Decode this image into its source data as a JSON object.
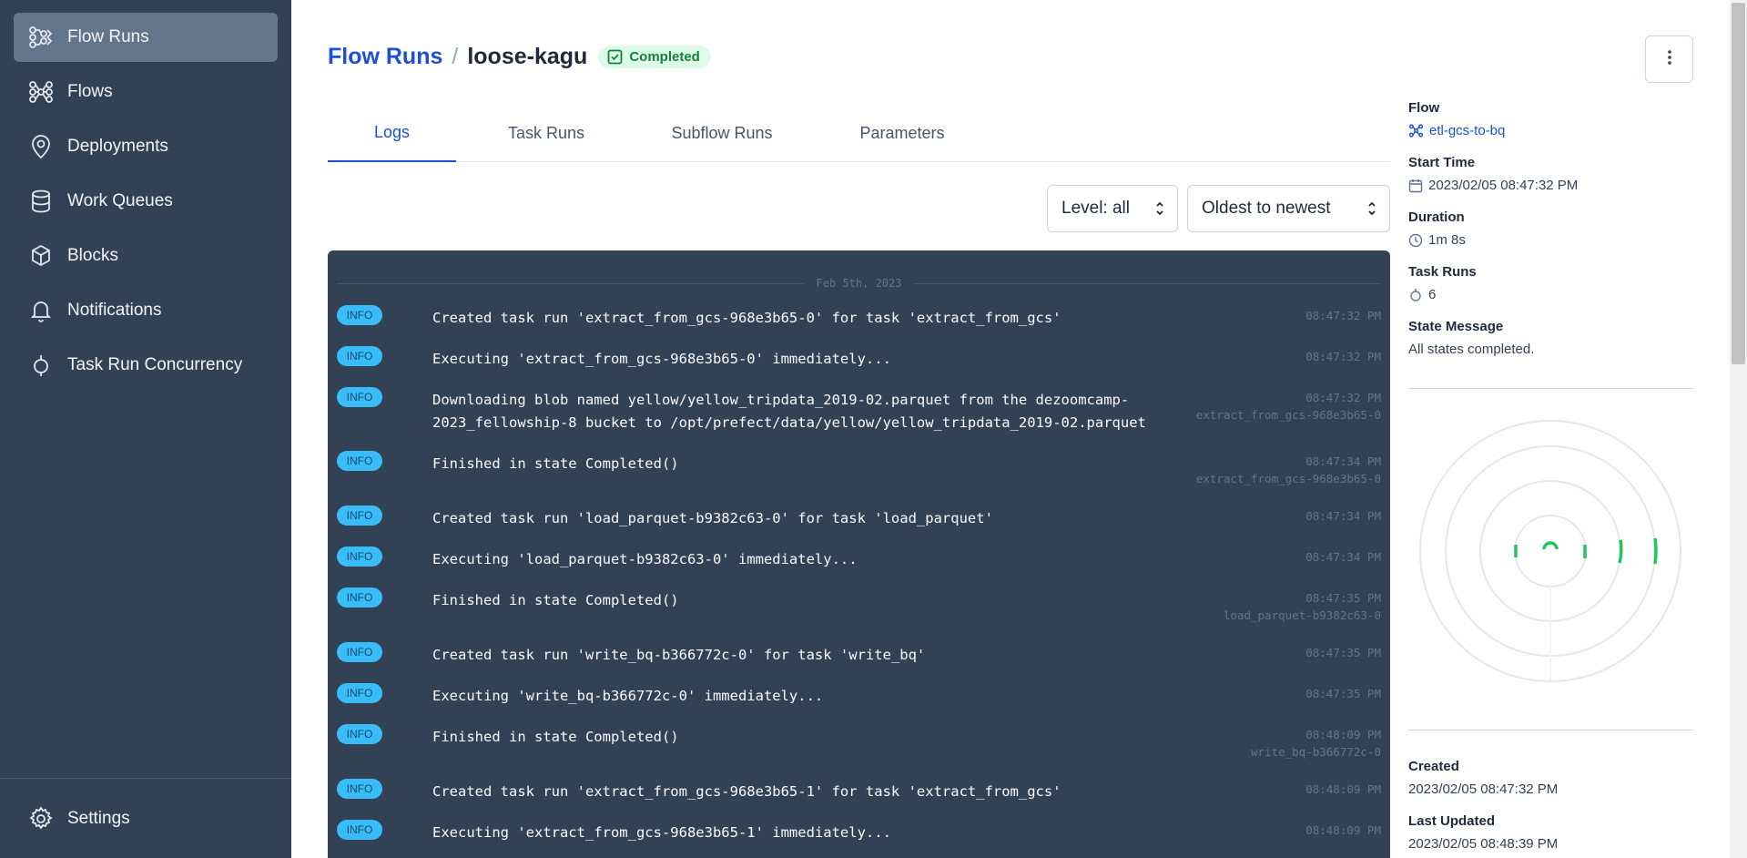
{
  "sidebar": {
    "items": [
      {
        "label": "Flow Runs",
        "icon": "flow-runs-icon"
      },
      {
        "label": "Flows",
        "icon": "flows-icon"
      },
      {
        "label": "Deployments",
        "icon": "location-pin-icon"
      },
      {
        "label": "Work Queues",
        "icon": "database-icon"
      },
      {
        "label": "Blocks",
        "icon": "cube-icon"
      },
      {
        "label": "Notifications",
        "icon": "bell-icon"
      },
      {
        "label": "Task Run Concurrency",
        "icon": "concurrency-icon"
      }
    ],
    "settings_label": "Settings"
  },
  "header": {
    "breadcrumb_root": "Flow Runs",
    "separator": "/",
    "run_name": "loose-kagu",
    "status": "Completed"
  },
  "tabs": [
    {
      "label": "Logs"
    },
    {
      "label": "Task Runs"
    },
    {
      "label": "Subflow Runs"
    },
    {
      "label": "Parameters"
    }
  ],
  "filters": {
    "level": "Level: all",
    "sort": "Oldest to newest"
  },
  "logs": {
    "date": "Feb 5th, 2023",
    "entries": [
      {
        "level": "INFO",
        "message": "Created task run 'extract_from_gcs-968e3b65-0' for task 'extract_from_gcs'",
        "time": "08:47:32 PM",
        "task": ""
      },
      {
        "level": "INFO",
        "message": "Executing 'extract_from_gcs-968e3b65-0' immediately...",
        "time": "08:47:32 PM",
        "task": ""
      },
      {
        "level": "INFO",
        "message": "Downloading blob named yellow/yellow_tripdata_2019-02.parquet from the dezoomcamp-2023_fellowship-8 bucket to /opt/prefect/data/yellow/yellow_tripdata_2019-02.parquet",
        "time": "08:47:32 PM",
        "task": "extract_from_gcs-968e3b65-0"
      },
      {
        "level": "INFO",
        "message": "Finished in state Completed()",
        "time": "08:47:34 PM",
        "task": "extract_from_gcs-968e3b65-0"
      },
      {
        "level": "INFO",
        "message": "Created task run 'load_parquet-b9382c63-0' for task 'load_parquet'",
        "time": "08:47:34 PM",
        "task": ""
      },
      {
        "level": "INFO",
        "message": "Executing 'load_parquet-b9382c63-0' immediately...",
        "time": "08:47:34 PM",
        "task": ""
      },
      {
        "level": "INFO",
        "message": "Finished in state Completed()",
        "time": "08:47:35 PM",
        "task": "load_parquet-b9382c63-0"
      },
      {
        "level": "INFO",
        "message": "Created task run 'write_bq-b366772c-0' for task 'write_bq'",
        "time": "08:47:35 PM",
        "task": ""
      },
      {
        "level": "INFO",
        "message": "Executing 'write_bq-b366772c-0' immediately...",
        "time": "08:47:35 PM",
        "task": ""
      },
      {
        "level": "INFO",
        "message": "Finished in state Completed()",
        "time": "08:48:09 PM",
        "task": "write_bq-b366772c-0"
      },
      {
        "level": "INFO",
        "message": "Created task run 'extract_from_gcs-968e3b65-1' for task 'extract_from_gcs'",
        "time": "08:48:09 PM",
        "task": ""
      },
      {
        "level": "INFO",
        "message": "Executing 'extract_from_gcs-968e3b65-1' immediately...",
        "time": "08:48:09 PM",
        "task": ""
      }
    ]
  },
  "details": {
    "flow_label": "Flow",
    "flow_value": "etl-gcs-to-bq",
    "start_time_label": "Start Time",
    "start_time_value": "2023/02/05 08:47:32 PM",
    "duration_label": "Duration",
    "duration_value": "1m 8s",
    "task_runs_label": "Task Runs",
    "task_runs_value": "6",
    "state_message_label": "State Message",
    "state_message_value": "All states completed.",
    "created_label": "Created",
    "created_value": "2023/02/05 08:47:32 PM",
    "last_updated_label": "Last Updated",
    "last_updated_value": "2023/02/05 08:48:39 PM"
  },
  "colors": {
    "sidebar_bg": "#334155",
    "accent": "#1d4ed8",
    "completed": "#22c55e",
    "log_bg": "#334155",
    "info_badge": "#38bdf8"
  }
}
